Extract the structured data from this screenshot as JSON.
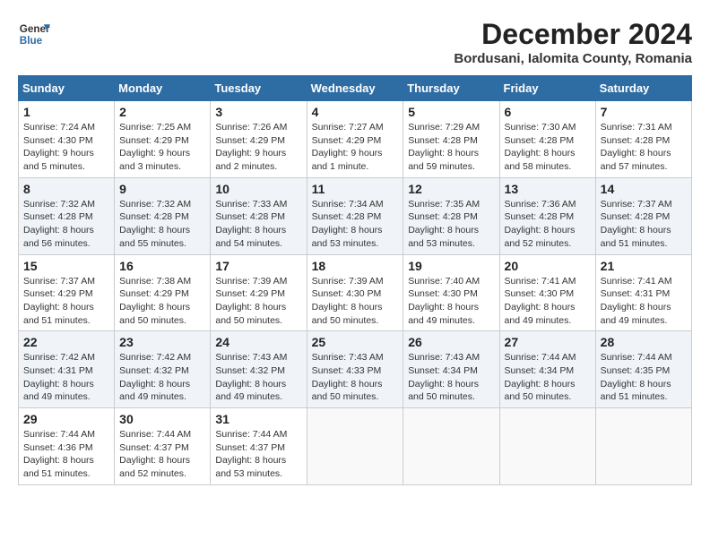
{
  "logo": {
    "line1": "General",
    "line2": "Blue"
  },
  "title": "December 2024",
  "subtitle": "Bordusani, Ialomita County, Romania",
  "days_header": [
    "Sunday",
    "Monday",
    "Tuesday",
    "Wednesday",
    "Thursday",
    "Friday",
    "Saturday"
  ],
  "weeks": [
    [
      {
        "day": "1",
        "sunrise": "Sunrise: 7:24 AM",
        "sunset": "Sunset: 4:30 PM",
        "daylight": "Daylight: 9 hours and 5 minutes."
      },
      {
        "day": "2",
        "sunrise": "Sunrise: 7:25 AM",
        "sunset": "Sunset: 4:29 PM",
        "daylight": "Daylight: 9 hours and 3 minutes."
      },
      {
        "day": "3",
        "sunrise": "Sunrise: 7:26 AM",
        "sunset": "Sunset: 4:29 PM",
        "daylight": "Daylight: 9 hours and 2 minutes."
      },
      {
        "day": "4",
        "sunrise": "Sunrise: 7:27 AM",
        "sunset": "Sunset: 4:29 PM",
        "daylight": "Daylight: 9 hours and 1 minute."
      },
      {
        "day": "5",
        "sunrise": "Sunrise: 7:29 AM",
        "sunset": "Sunset: 4:28 PM",
        "daylight": "Daylight: 8 hours and 59 minutes."
      },
      {
        "day": "6",
        "sunrise": "Sunrise: 7:30 AM",
        "sunset": "Sunset: 4:28 PM",
        "daylight": "Daylight: 8 hours and 58 minutes."
      },
      {
        "day": "7",
        "sunrise": "Sunrise: 7:31 AM",
        "sunset": "Sunset: 4:28 PM",
        "daylight": "Daylight: 8 hours and 57 minutes."
      }
    ],
    [
      {
        "day": "8",
        "sunrise": "Sunrise: 7:32 AM",
        "sunset": "Sunset: 4:28 PM",
        "daylight": "Daylight: 8 hours and 56 minutes."
      },
      {
        "day": "9",
        "sunrise": "Sunrise: 7:32 AM",
        "sunset": "Sunset: 4:28 PM",
        "daylight": "Daylight: 8 hours and 55 minutes."
      },
      {
        "day": "10",
        "sunrise": "Sunrise: 7:33 AM",
        "sunset": "Sunset: 4:28 PM",
        "daylight": "Daylight: 8 hours and 54 minutes."
      },
      {
        "day": "11",
        "sunrise": "Sunrise: 7:34 AM",
        "sunset": "Sunset: 4:28 PM",
        "daylight": "Daylight: 8 hours and 53 minutes."
      },
      {
        "day": "12",
        "sunrise": "Sunrise: 7:35 AM",
        "sunset": "Sunset: 4:28 PM",
        "daylight": "Daylight: 8 hours and 53 minutes."
      },
      {
        "day": "13",
        "sunrise": "Sunrise: 7:36 AM",
        "sunset": "Sunset: 4:28 PM",
        "daylight": "Daylight: 8 hours and 52 minutes."
      },
      {
        "day": "14",
        "sunrise": "Sunrise: 7:37 AM",
        "sunset": "Sunset: 4:28 PM",
        "daylight": "Daylight: 8 hours and 51 minutes."
      }
    ],
    [
      {
        "day": "15",
        "sunrise": "Sunrise: 7:37 AM",
        "sunset": "Sunset: 4:29 PM",
        "daylight": "Daylight: 8 hours and 51 minutes."
      },
      {
        "day": "16",
        "sunrise": "Sunrise: 7:38 AM",
        "sunset": "Sunset: 4:29 PM",
        "daylight": "Daylight: 8 hours and 50 minutes."
      },
      {
        "day": "17",
        "sunrise": "Sunrise: 7:39 AM",
        "sunset": "Sunset: 4:29 PM",
        "daylight": "Daylight: 8 hours and 50 minutes."
      },
      {
        "day": "18",
        "sunrise": "Sunrise: 7:39 AM",
        "sunset": "Sunset: 4:30 PM",
        "daylight": "Daylight: 8 hours and 50 minutes."
      },
      {
        "day": "19",
        "sunrise": "Sunrise: 7:40 AM",
        "sunset": "Sunset: 4:30 PM",
        "daylight": "Daylight: 8 hours and 49 minutes."
      },
      {
        "day": "20",
        "sunrise": "Sunrise: 7:41 AM",
        "sunset": "Sunset: 4:30 PM",
        "daylight": "Daylight: 8 hours and 49 minutes."
      },
      {
        "day": "21",
        "sunrise": "Sunrise: 7:41 AM",
        "sunset": "Sunset: 4:31 PM",
        "daylight": "Daylight: 8 hours and 49 minutes."
      }
    ],
    [
      {
        "day": "22",
        "sunrise": "Sunrise: 7:42 AM",
        "sunset": "Sunset: 4:31 PM",
        "daylight": "Daylight: 8 hours and 49 minutes."
      },
      {
        "day": "23",
        "sunrise": "Sunrise: 7:42 AM",
        "sunset": "Sunset: 4:32 PM",
        "daylight": "Daylight: 8 hours and 49 minutes."
      },
      {
        "day": "24",
        "sunrise": "Sunrise: 7:43 AM",
        "sunset": "Sunset: 4:32 PM",
        "daylight": "Daylight: 8 hours and 49 minutes."
      },
      {
        "day": "25",
        "sunrise": "Sunrise: 7:43 AM",
        "sunset": "Sunset: 4:33 PM",
        "daylight": "Daylight: 8 hours and 50 minutes."
      },
      {
        "day": "26",
        "sunrise": "Sunrise: 7:43 AM",
        "sunset": "Sunset: 4:34 PM",
        "daylight": "Daylight: 8 hours and 50 minutes."
      },
      {
        "day": "27",
        "sunrise": "Sunrise: 7:44 AM",
        "sunset": "Sunset: 4:34 PM",
        "daylight": "Daylight: 8 hours and 50 minutes."
      },
      {
        "day": "28",
        "sunrise": "Sunrise: 7:44 AM",
        "sunset": "Sunset: 4:35 PM",
        "daylight": "Daylight: 8 hours and 51 minutes."
      }
    ],
    [
      {
        "day": "29",
        "sunrise": "Sunrise: 7:44 AM",
        "sunset": "Sunset: 4:36 PM",
        "daylight": "Daylight: 8 hours and 51 minutes."
      },
      {
        "day": "30",
        "sunrise": "Sunrise: 7:44 AM",
        "sunset": "Sunset: 4:37 PM",
        "daylight": "Daylight: 8 hours and 52 minutes."
      },
      {
        "day": "31",
        "sunrise": "Sunrise: 7:44 AM",
        "sunset": "Sunset: 4:37 PM",
        "daylight": "Daylight: 8 hours and 53 minutes."
      },
      null,
      null,
      null,
      null
    ]
  ]
}
